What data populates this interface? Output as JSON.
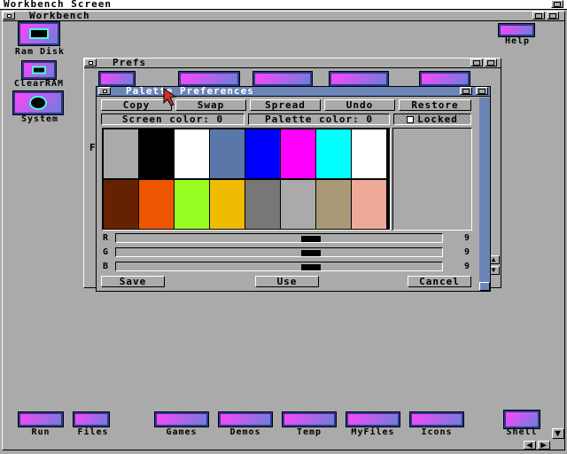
{
  "screen": {
    "title": "Workbench Screen"
  },
  "workbench_window": {
    "title": "Workbench"
  },
  "desktop_icons": [
    {
      "label": "Ram Disk"
    },
    {
      "label": "ClearRAM"
    },
    {
      "label": "System"
    },
    {
      "label": "Help"
    }
  ],
  "bottom_icons": [
    {
      "label": "Run"
    },
    {
      "label": "Files"
    },
    {
      "label": "Games"
    },
    {
      "label": "Demos"
    },
    {
      "label": "Temp"
    },
    {
      "label": "MyFiles"
    },
    {
      "label": "Icons"
    },
    {
      "label": "Shell"
    }
  ],
  "prefs_window": {
    "title": "Prefs",
    "partial_label": "F"
  },
  "palette": {
    "title": "Palette Preferences",
    "buttons": {
      "copy": "Copy",
      "swap": "Swap",
      "spread": "Spread",
      "undo": "Undo",
      "restore": "Restore"
    },
    "screen_color": "Screen color: 0",
    "palette_color": "Palette color: 0",
    "locked": "Locked",
    "colors": [
      "#aaaaaa",
      "#000000",
      "#ffffff",
      "#5a77aa",
      "#0000ff",
      "#ff00ff",
      "#00ffff",
      "#ffffff",
      "#662200",
      "#ee5500",
      "#99ff22",
      "#eebb00",
      "#777777",
      "#aaaaaa",
      "#aa9977",
      "#eeaa99"
    ],
    "sliders": [
      {
        "label": "R",
        "value": "9",
        "level": 0.6
      },
      {
        "label": "G",
        "value": "9",
        "level": 0.6
      },
      {
        "label": "B",
        "value": "9",
        "level": 0.6
      }
    ],
    "actions": {
      "save": "Save",
      "use": "Use",
      "cancel": "Cancel"
    }
  }
}
